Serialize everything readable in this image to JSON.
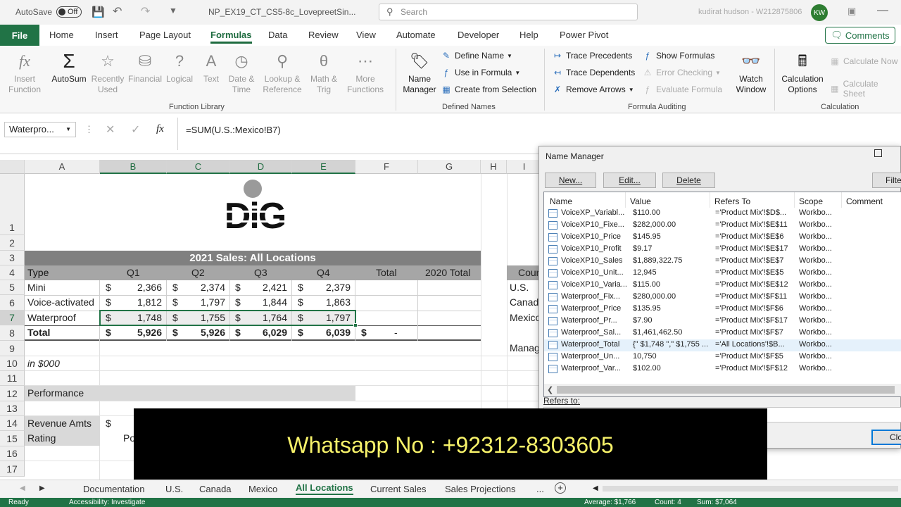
{
  "titlebar": {
    "autosave_label": "AutoSave",
    "autosave_state": "Off",
    "filename": "NP_EX19_CT_CS5-8c_LovepreetSin...",
    "search_placeholder": "Search",
    "user": "kudirat hudson - W212875806",
    "initials": "KW"
  },
  "tabs": [
    "File",
    "Home",
    "Insert",
    "Page Layout",
    "Formulas",
    "Data",
    "Review",
    "View",
    "Automate",
    "Developer",
    "Help",
    "Power Pivot"
  ],
  "active_tab": "Formulas",
  "comments_label": "Comments",
  "ribbon": {
    "function_library": {
      "buttons": [
        {
          "label": "Insert\nFunction",
          "enabled": false
        },
        {
          "label": "AutoSum",
          "enabled": true
        },
        {
          "label": "Recently\nUsed",
          "enabled": false
        },
        {
          "label": "Financial",
          "enabled": false
        },
        {
          "label": "Logical",
          "enabled": false
        },
        {
          "label": "Text",
          "enabled": false
        },
        {
          "label": "Date &\nTime",
          "enabled": false
        },
        {
          "label": "Lookup &\nReference",
          "enabled": false
        },
        {
          "label": "Math &\nTrig",
          "enabled": false
        },
        {
          "label": "More\nFunctions",
          "enabled": false
        }
      ],
      "group_label": "Function Library"
    },
    "defined_names": {
      "name_manager": "Name\nManager",
      "define_name": "Define Name",
      "use_in_formula": "Use in Formula",
      "create_from_selection": "Create from Selection",
      "group_label": "Defined Names"
    },
    "formula_auditing": {
      "trace_precedents": "Trace Precedents",
      "trace_dependents": "Trace Dependents",
      "remove_arrows": "Remove Arrows",
      "show_formulas": "Show Formulas",
      "error_checking": "Error Checking",
      "evaluate_formula": "Evaluate Formula",
      "watch_window": "Watch\nWindow",
      "group_label": "Formula Auditing"
    },
    "calculation": {
      "options": "Calculation\nOptions",
      "calc_now": "Calculate Now",
      "calc_sheet": "Calculate Sheet",
      "group_label": "Calculation"
    }
  },
  "formula_bar": {
    "name_box": "Waterpro...",
    "formula": "=SUM(U.S.:Mexico!B7)",
    "fx": "fx"
  },
  "columns": [
    "A",
    "B",
    "C",
    "D",
    "E",
    "F",
    "G",
    "H",
    "I"
  ],
  "rows": [
    "1",
    "2",
    "3",
    "4",
    "5",
    "6",
    "7",
    "8",
    "9",
    "10",
    "11",
    "12",
    "13",
    "14",
    "15",
    "16",
    "17"
  ],
  "sheet": {
    "title": "2021 Sales: All Locations",
    "logo_text": "DiG",
    "headers": [
      "Type",
      "Q1",
      "Q2",
      "Q3",
      "Q4",
      "Total",
      "2020 Total"
    ],
    "data": [
      {
        "type": "Mini",
        "q": [
          "2,366",
          "2,374",
          "2,421",
          "2,379"
        ]
      },
      {
        "type": "Voice-activated",
        "q": [
          "1,812",
          "1,797",
          "1,844",
          "1,863"
        ]
      },
      {
        "type": "Waterproof",
        "q": [
          "1,748",
          "1,755",
          "1,764",
          "1,797"
        ]
      }
    ],
    "total_label": "Total",
    "totals": [
      "5,926",
      "5,926",
      "6,029",
      "6,039"
    ],
    "total_f": "-",
    "currency": "$",
    "in_thousands": "in $000",
    "performance": "Performance",
    "revenue_amts": "Revenue Amts",
    "rating": "Rating",
    "rating_partial": "Po",
    "side_col": [
      "Cour",
      "U.S.",
      "Canad",
      "Mexico",
      "Manag"
    ]
  },
  "name_manager": {
    "title": "Name Manager",
    "buttons": [
      "New...",
      "Edit...",
      "Delete",
      "Filte"
    ],
    "columns": [
      "Name",
      "Value",
      "Refers To",
      "Scope",
      "Comment"
    ],
    "rows": [
      {
        "name": "VoiceXP_Variabl...",
        "value": "$110.00",
        "refers": "='Product Mix'!$D$...",
        "scope": "Workbo..."
      },
      {
        "name": "VoiceXP10_Fixe...",
        "value": "$282,000.00",
        "refers": "='Product Mix'!$E$11",
        "scope": "Workbo..."
      },
      {
        "name": "VoiceXP10_Price",
        "value": "$145.95",
        "refers": "='Product Mix'!$E$6",
        "scope": "Workbo..."
      },
      {
        "name": "VoiceXP10_Profit",
        "value": "$9.17",
        "refers": "='Product Mix'!$E$17",
        "scope": "Workbo..."
      },
      {
        "name": "VoiceXP10_Sales",
        "value": "$1,889,322.75",
        "refers": "='Product Mix'!$E$7",
        "scope": "Workbo..."
      },
      {
        "name": "VoiceXP10_Unit...",
        "value": "12,945",
        "refers": "='Product Mix'!$E$5",
        "scope": "Workbo..."
      },
      {
        "name": "VoiceXP10_Varia...",
        "value": "$115.00",
        "refers": "='Product Mix'!$E$12",
        "scope": "Workbo..."
      },
      {
        "name": "Waterproof_Fix...",
        "value": "$280,000.00",
        "refers": "='Product Mix'!$F$11",
        "scope": "Workbo..."
      },
      {
        "name": "Waterproof_Price",
        "value": "$135.95",
        "refers": "='Product Mix'!$F$6",
        "scope": "Workbo..."
      },
      {
        "name": "Waterproof_Pr...",
        "value": "$7.90",
        "refers": "='Product Mix'!$F$17",
        "scope": "Workbo..."
      },
      {
        "name": "Waterproof_Sal...",
        "value": "$1,461,462.50",
        "refers": "='Product Mix'!$F$7",
        "scope": "Workbo..."
      },
      {
        "name": "Waterproof_Total",
        "value": "{\" $1,748 \",\" $1,755 ...",
        "refers": "='All Locations'!$B...",
        "scope": "Workbo..."
      },
      {
        "name": "Waterproof_Un...",
        "value": "10,750",
        "refers": "='Product Mix'!$F$5",
        "scope": "Workbo..."
      },
      {
        "name": "Waterproof_Var...",
        "value": "$102.00",
        "refers": "='Product Mix'!$F$12",
        "scope": "Workbo..."
      }
    ],
    "selected_row": 11,
    "refers_to_label": "Refers to:",
    "close_label": "Clo"
  },
  "overlay_text": "Whatsapp No : +92312-8303605",
  "sheet_tabs": [
    "Documentation",
    "U.S.",
    "Canada",
    "Mexico",
    "All Locations",
    "Current Sales",
    "Sales Projections"
  ],
  "active_sheet": "All Locations",
  "ellipsis": "...",
  "status": {
    "ready": "Ready",
    "accessibility": "Accessibility: Investigate",
    "average": "Average: $1,766",
    "count": "Count: 4",
    "sum": "Sum: $7,064"
  },
  "colors": {
    "excel_green": "#217346",
    "header_band": "#808080",
    "table_band": "#a6a6a6"
  }
}
